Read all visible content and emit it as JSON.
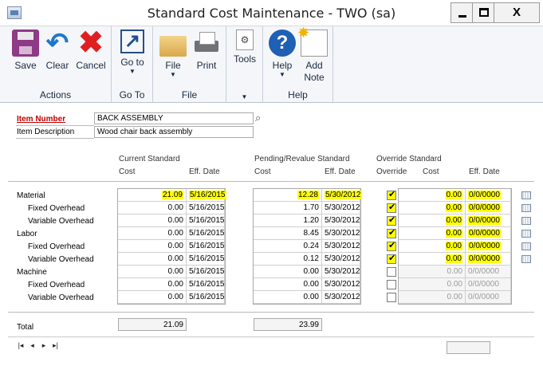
{
  "window": {
    "title": "Standard Cost Maintenance  -  TWO (sa)",
    "controls": {
      "minimize": "—",
      "maximize": "☐",
      "close": "X"
    }
  },
  "ribbon": {
    "groups": {
      "actions": {
        "label": "Actions",
        "buttons": {
          "save": "Save",
          "clear": "Clear",
          "cancel": "Cancel"
        }
      },
      "goto": {
        "label": "Go To",
        "buttons": {
          "goto": "Go to"
        }
      },
      "file": {
        "label": "File",
        "buttons": {
          "file": "File",
          "print": "Print"
        }
      },
      "tools": {
        "label": "",
        "buttons": {
          "tools": "Tools"
        }
      },
      "help": {
        "label": "Help",
        "buttons": {
          "help": "Help",
          "add_note_1": "Add",
          "add_note_2": "Note"
        }
      }
    }
  },
  "form": {
    "item_number_label": "Item Number",
    "item_number_value": "BACK ASSEMBLY",
    "item_description_label": "Item Description",
    "item_description_value": "Wood chair back assembly",
    "headers": {
      "current_standard": "Current Standard",
      "current_cost": "Cost",
      "current_eff_date": "Eff. Date",
      "pending_revalue": "Pending/Revalue Standard",
      "pending_cost": "Cost",
      "pending_eff_date": "Eff. Date",
      "override_standard": "Override Standard",
      "override": "Override",
      "override_cost": "Cost",
      "override_eff_date": "Eff. Date"
    },
    "rows": [
      {
        "label": "Material",
        "indent": false,
        "current_cost": "21.09",
        "current_date": "5/16/2015",
        "pending_cost": "12.28",
        "pending_date": "5/30/2012",
        "override": true,
        "override_cost": "0.00",
        "override_date": "0/0/0000"
      },
      {
        "label": "Fixed Overhead",
        "indent": true,
        "current_cost": "0.00",
        "current_date": "5/16/2015",
        "pending_cost": "1.70",
        "pending_date": "5/30/2012",
        "override": true,
        "override_cost": "0.00",
        "override_date": "0/0/0000"
      },
      {
        "label": "Variable Overhead",
        "indent": true,
        "current_cost": "0.00",
        "current_date": "5/16/2015",
        "pending_cost": "1.20",
        "pending_date": "5/30/2012",
        "override": true,
        "override_cost": "0.00",
        "override_date": "0/0/0000"
      },
      {
        "label": "Labor",
        "indent": false,
        "current_cost": "0.00",
        "current_date": "5/16/2015",
        "pending_cost": "8.45",
        "pending_date": "5/30/2012",
        "override": true,
        "override_cost": "0.00",
        "override_date": "0/0/0000"
      },
      {
        "label": "Fixed Overhead",
        "indent": true,
        "current_cost": "0.00",
        "current_date": "5/16/2015",
        "pending_cost": "0.24",
        "pending_date": "5/30/2012",
        "override": true,
        "override_cost": "0.00",
        "override_date": "0/0/0000"
      },
      {
        "label": "Variable Overhead",
        "indent": true,
        "current_cost": "0.00",
        "current_date": "5/16/2015",
        "pending_cost": "0.12",
        "pending_date": "5/30/2012",
        "override": true,
        "override_cost": "0.00",
        "override_date": "0/0/0000"
      },
      {
        "label": "Machine",
        "indent": false,
        "current_cost": "0.00",
        "current_date": "5/16/2015",
        "pending_cost": "0.00",
        "pending_date": "5/30/2012",
        "override": false,
        "override_cost": "0.00",
        "override_date": "0/0/0000"
      },
      {
        "label": "Fixed Overhead",
        "indent": true,
        "current_cost": "0.00",
        "current_date": "5/16/2015",
        "pending_cost": "0.00",
        "pending_date": "5/30/2012",
        "override": false,
        "override_cost": "0.00",
        "override_date": "0/0/0000"
      },
      {
        "label": "Variable Overhead",
        "indent": true,
        "current_cost": "0.00",
        "current_date": "5/16/2015",
        "pending_cost": "0.00",
        "pending_date": "5/30/2012",
        "override": false,
        "override_cost": "0.00",
        "override_date": "0/0/0000"
      }
    ],
    "total_label": "Total",
    "total_current": "21.09",
    "total_pending": "23.99"
  },
  "navigation": {
    "first": "|◂",
    "prev": "◂",
    "next": "▸",
    "last": "▸|"
  },
  "colors": {
    "highlight": "#ffff00",
    "required_label": "#c00000"
  }
}
